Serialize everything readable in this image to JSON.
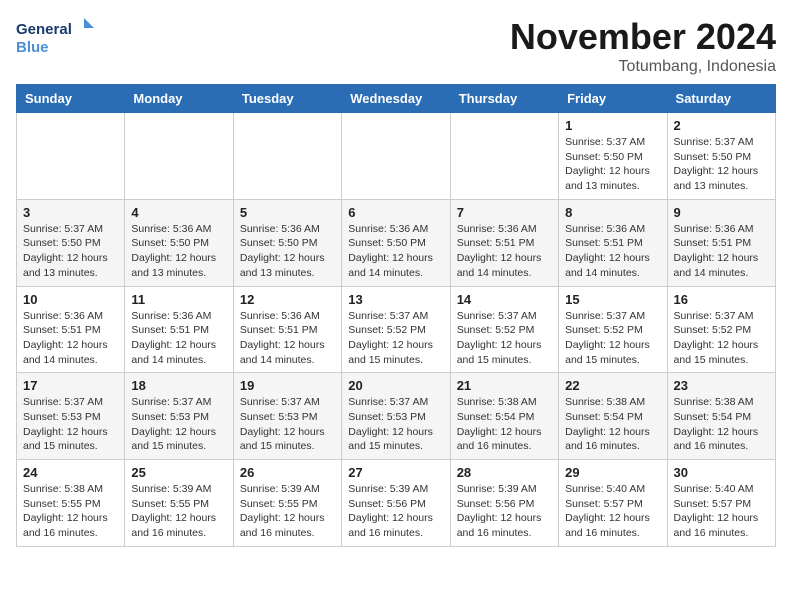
{
  "header": {
    "logo_line1": "General",
    "logo_line2": "Blue",
    "month_title": "November 2024",
    "location": "Totumbang, Indonesia"
  },
  "weekdays": [
    "Sunday",
    "Monday",
    "Tuesday",
    "Wednesday",
    "Thursday",
    "Friday",
    "Saturday"
  ],
  "weeks": [
    [
      {
        "day": "",
        "info": ""
      },
      {
        "day": "",
        "info": ""
      },
      {
        "day": "",
        "info": ""
      },
      {
        "day": "",
        "info": ""
      },
      {
        "day": "",
        "info": ""
      },
      {
        "day": "1",
        "info": "Sunrise: 5:37 AM\nSunset: 5:50 PM\nDaylight: 12 hours\nand 13 minutes."
      },
      {
        "day": "2",
        "info": "Sunrise: 5:37 AM\nSunset: 5:50 PM\nDaylight: 12 hours\nand 13 minutes."
      }
    ],
    [
      {
        "day": "3",
        "info": "Sunrise: 5:37 AM\nSunset: 5:50 PM\nDaylight: 12 hours\nand 13 minutes."
      },
      {
        "day": "4",
        "info": "Sunrise: 5:36 AM\nSunset: 5:50 PM\nDaylight: 12 hours\nand 13 minutes."
      },
      {
        "day": "5",
        "info": "Sunrise: 5:36 AM\nSunset: 5:50 PM\nDaylight: 12 hours\nand 13 minutes."
      },
      {
        "day": "6",
        "info": "Sunrise: 5:36 AM\nSunset: 5:50 PM\nDaylight: 12 hours\nand 14 minutes."
      },
      {
        "day": "7",
        "info": "Sunrise: 5:36 AM\nSunset: 5:51 PM\nDaylight: 12 hours\nand 14 minutes."
      },
      {
        "day": "8",
        "info": "Sunrise: 5:36 AM\nSunset: 5:51 PM\nDaylight: 12 hours\nand 14 minutes."
      },
      {
        "day": "9",
        "info": "Sunrise: 5:36 AM\nSunset: 5:51 PM\nDaylight: 12 hours\nand 14 minutes."
      }
    ],
    [
      {
        "day": "10",
        "info": "Sunrise: 5:36 AM\nSunset: 5:51 PM\nDaylight: 12 hours\nand 14 minutes."
      },
      {
        "day": "11",
        "info": "Sunrise: 5:36 AM\nSunset: 5:51 PM\nDaylight: 12 hours\nand 14 minutes."
      },
      {
        "day": "12",
        "info": "Sunrise: 5:36 AM\nSunset: 5:51 PM\nDaylight: 12 hours\nand 14 minutes."
      },
      {
        "day": "13",
        "info": "Sunrise: 5:37 AM\nSunset: 5:52 PM\nDaylight: 12 hours\nand 15 minutes."
      },
      {
        "day": "14",
        "info": "Sunrise: 5:37 AM\nSunset: 5:52 PM\nDaylight: 12 hours\nand 15 minutes."
      },
      {
        "day": "15",
        "info": "Sunrise: 5:37 AM\nSunset: 5:52 PM\nDaylight: 12 hours\nand 15 minutes."
      },
      {
        "day": "16",
        "info": "Sunrise: 5:37 AM\nSunset: 5:52 PM\nDaylight: 12 hours\nand 15 minutes."
      }
    ],
    [
      {
        "day": "17",
        "info": "Sunrise: 5:37 AM\nSunset: 5:53 PM\nDaylight: 12 hours\nand 15 minutes."
      },
      {
        "day": "18",
        "info": "Sunrise: 5:37 AM\nSunset: 5:53 PM\nDaylight: 12 hours\nand 15 minutes."
      },
      {
        "day": "19",
        "info": "Sunrise: 5:37 AM\nSunset: 5:53 PM\nDaylight: 12 hours\nand 15 minutes."
      },
      {
        "day": "20",
        "info": "Sunrise: 5:37 AM\nSunset: 5:53 PM\nDaylight: 12 hours\nand 15 minutes."
      },
      {
        "day": "21",
        "info": "Sunrise: 5:38 AM\nSunset: 5:54 PM\nDaylight: 12 hours\nand 16 minutes."
      },
      {
        "day": "22",
        "info": "Sunrise: 5:38 AM\nSunset: 5:54 PM\nDaylight: 12 hours\nand 16 minutes."
      },
      {
        "day": "23",
        "info": "Sunrise: 5:38 AM\nSunset: 5:54 PM\nDaylight: 12 hours\nand 16 minutes."
      }
    ],
    [
      {
        "day": "24",
        "info": "Sunrise: 5:38 AM\nSunset: 5:55 PM\nDaylight: 12 hours\nand 16 minutes."
      },
      {
        "day": "25",
        "info": "Sunrise: 5:39 AM\nSunset: 5:55 PM\nDaylight: 12 hours\nand 16 minutes."
      },
      {
        "day": "26",
        "info": "Sunrise: 5:39 AM\nSunset: 5:55 PM\nDaylight: 12 hours\nand 16 minutes."
      },
      {
        "day": "27",
        "info": "Sunrise: 5:39 AM\nSunset: 5:56 PM\nDaylight: 12 hours\nand 16 minutes."
      },
      {
        "day": "28",
        "info": "Sunrise: 5:39 AM\nSunset: 5:56 PM\nDaylight: 12 hours\nand 16 minutes."
      },
      {
        "day": "29",
        "info": "Sunrise: 5:40 AM\nSunset: 5:57 PM\nDaylight: 12 hours\nand 16 minutes."
      },
      {
        "day": "30",
        "info": "Sunrise: 5:40 AM\nSunset: 5:57 PM\nDaylight: 12 hours\nand 16 minutes."
      }
    ]
  ]
}
